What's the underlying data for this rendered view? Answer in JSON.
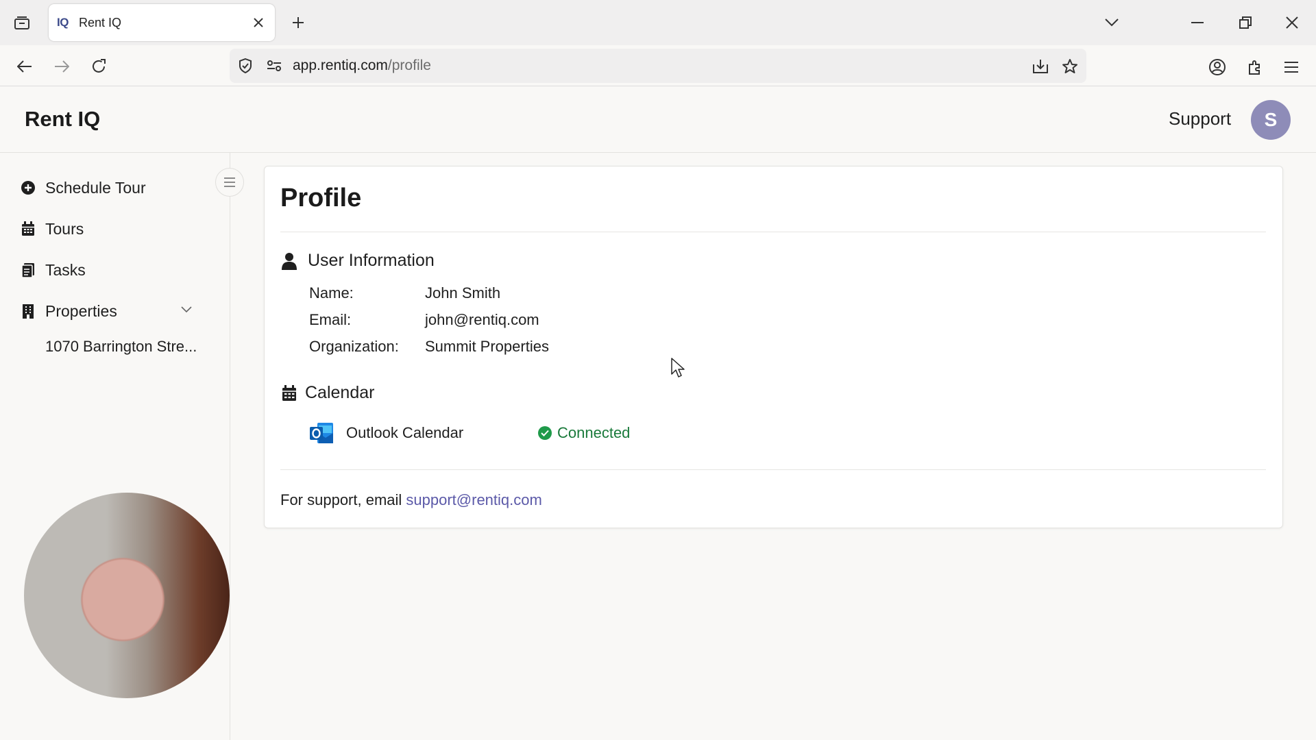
{
  "browser": {
    "tab_title": "Rent IQ",
    "tab_favicon": "IQ",
    "url_host": "app.rentiq.com",
    "url_path": "/profile"
  },
  "header": {
    "logo": "Rent IQ",
    "support_label": "Support",
    "avatar_initial": "S",
    "avatar_color": "#8e8cb8"
  },
  "sidebar": {
    "items": [
      {
        "label": "Schedule Tour",
        "icon": "plus-circle-icon"
      },
      {
        "label": "Tours",
        "icon": "calendar-icon"
      },
      {
        "label": "Tasks",
        "icon": "clipboard-icon"
      },
      {
        "label": "Properties",
        "icon": "building-icon"
      }
    ],
    "sub_items": [
      {
        "label": "1070 Barrington Stre..."
      }
    ]
  },
  "profile": {
    "title": "Profile",
    "user_section_title": "User Information",
    "fields": [
      {
        "label": "Name:",
        "value": "John Smith"
      },
      {
        "label": "Email:",
        "value": "john@rentiq.com"
      },
      {
        "label": "Organization:",
        "value": "Summit Properties"
      }
    ],
    "calendar_section_title": "Calendar",
    "calendar": {
      "name": "Outlook Calendar",
      "status": "Connected",
      "status_color": "#1a7a3b"
    },
    "support_prefix": "For support, email ",
    "support_email": "support@rentiq.com",
    "link_color": "#5b59a8"
  }
}
